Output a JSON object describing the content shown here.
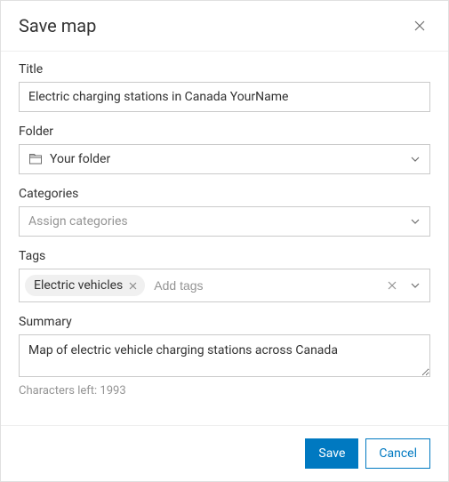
{
  "dialog": {
    "title": "Save map"
  },
  "fields": {
    "title": {
      "label": "Title",
      "value": "Electric charging stations in Canada YourName"
    },
    "folder": {
      "label": "Folder",
      "value": "Your folder"
    },
    "categories": {
      "label": "Categories",
      "placeholder": "Assign categories"
    },
    "tags": {
      "label": "Tags",
      "chips": [
        "Electric vehicles"
      ],
      "placeholder": "Add tags"
    },
    "summary": {
      "label": "Summary",
      "value": "Map of electric vehicle charging stations across Canada",
      "helper": "Characters left: 1993"
    }
  },
  "actions": {
    "save": "Save",
    "cancel": "Cancel"
  }
}
